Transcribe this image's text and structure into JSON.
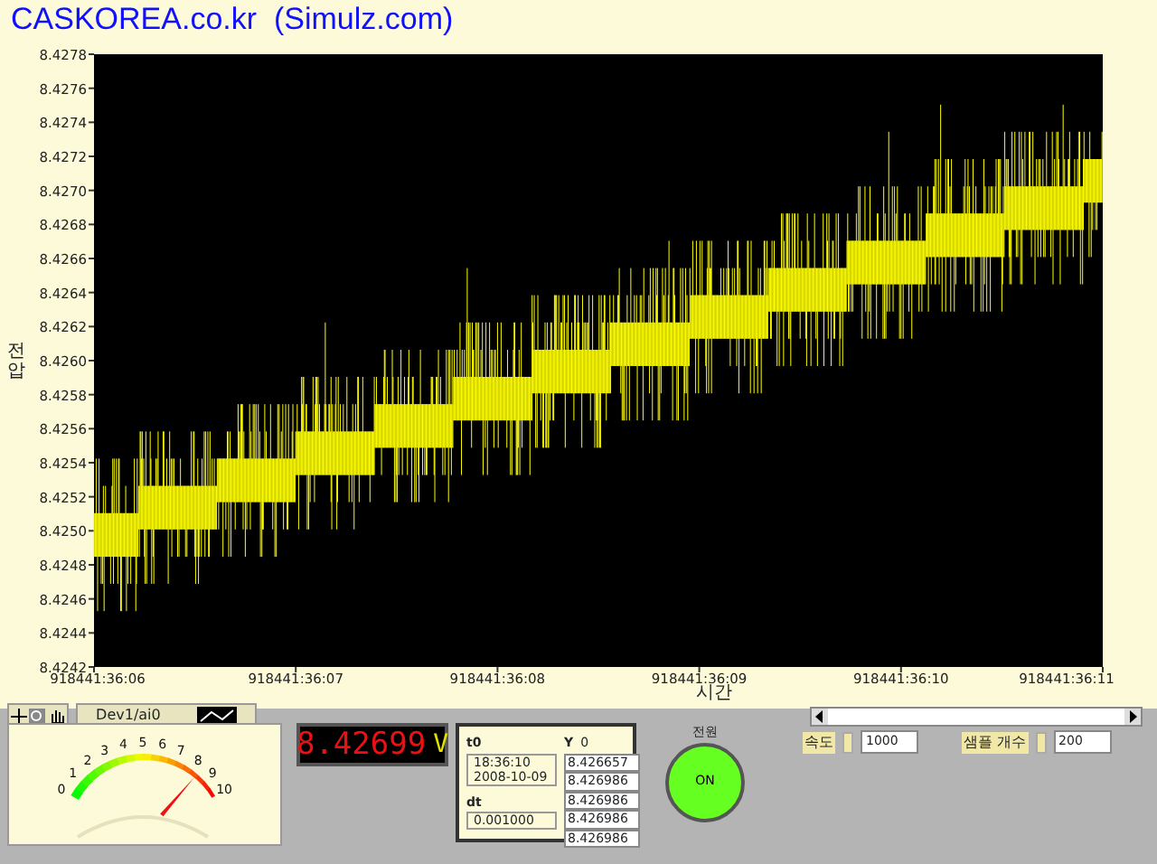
{
  "title": "CASKOREA.co.kr  (Simulz.com)",
  "graph": {
    "y_label": "전압",
    "x_label": "시간",
    "y_ticks": [
      "8.4278",
      "8.4276",
      "8.4274",
      "8.4272",
      "8.4270",
      "8.4268",
      "8.4266",
      "8.4264",
      "8.4262",
      "8.4260",
      "8.4258",
      "8.4256",
      "8.4254",
      "8.4252",
      "8.4250",
      "8.4248",
      "8.4246",
      "8.4244",
      "8.4242"
    ],
    "x_ticks": [
      "918441:36:06",
      "918441:36:07",
      "918441:36:08",
      "918441:36:09",
      "918441:36:10",
      "918441:36:11"
    ]
  },
  "legend": {
    "label": "Dev1/ai0"
  },
  "meter": {
    "scale": [
      "0",
      "1",
      "2",
      "3",
      "4",
      "5",
      "6",
      "7",
      "8",
      "9",
      "10"
    ],
    "level": 0.84
  },
  "display": {
    "value": "8.42699",
    "unit": "V"
  },
  "waveform_info": {
    "t0_label": "t0",
    "t0_time": "18:36:10",
    "t0_date": "2008-10-09",
    "dt_label": "dt",
    "dt": "0.001000",
    "y_label": "Y",
    "index": "0",
    "values": [
      "8.426657",
      "8.426986",
      "8.426986",
      "8.426986",
      "8.426986"
    ]
  },
  "power": {
    "label": "전원",
    "text": "ON",
    "on": true
  },
  "controls": [
    {
      "label": "속도",
      "value": "1000"
    },
    {
      "label": "샘플 개수",
      "value": "200"
    }
  ]
}
